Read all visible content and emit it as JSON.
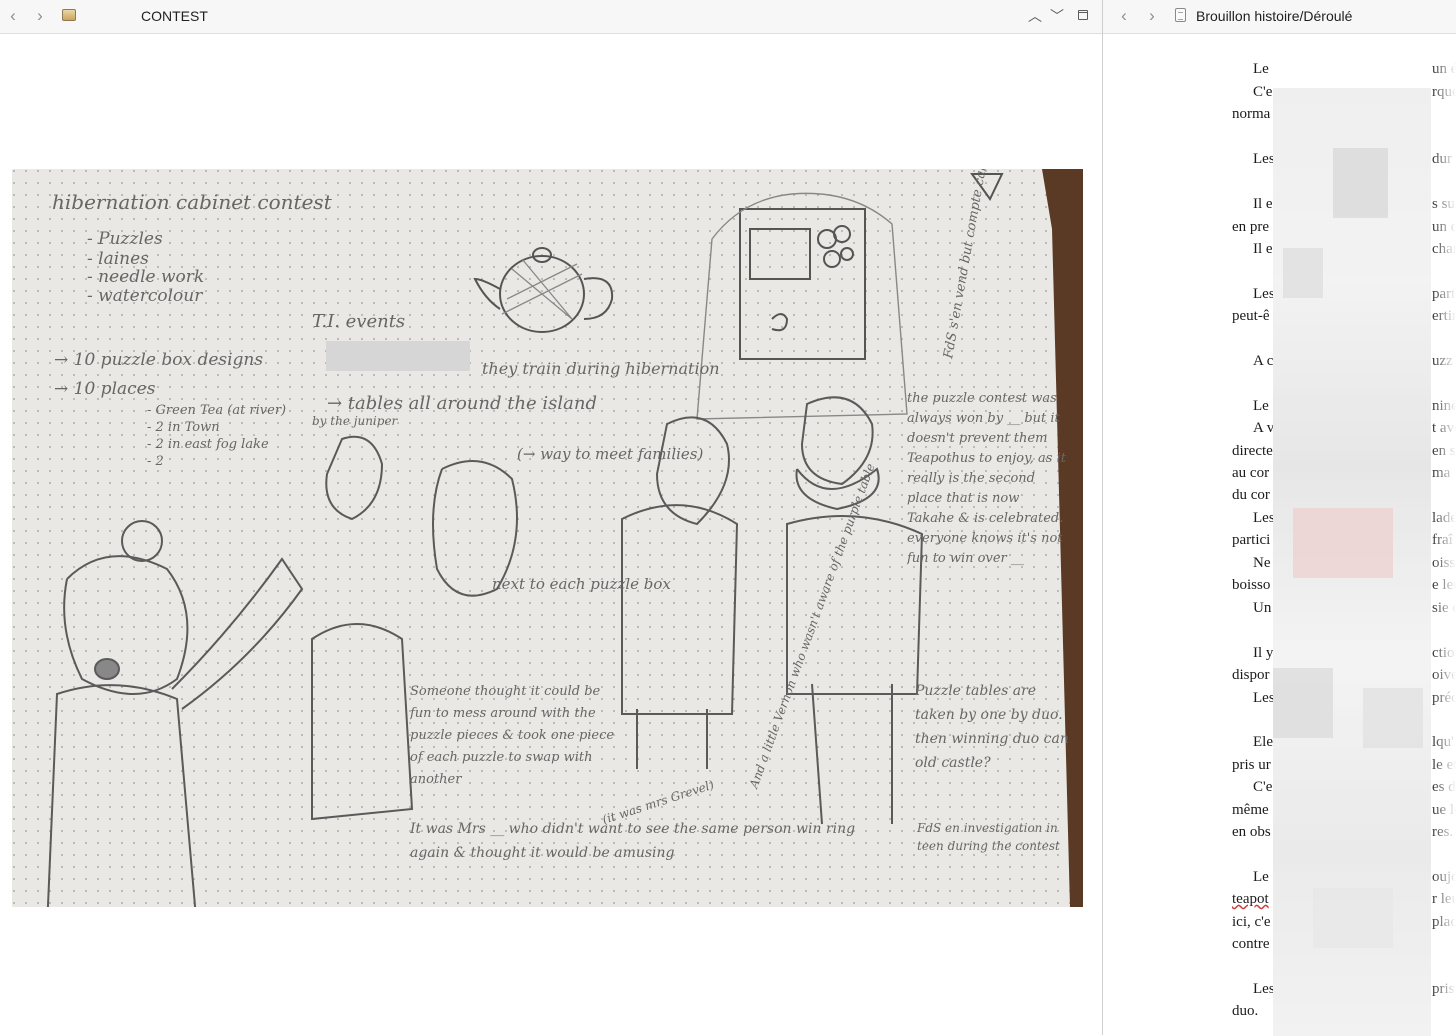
{
  "left_window": {
    "title": "CONTEST",
    "nav_back_icon": "chevron-left-icon",
    "nav_forward_icon": "chevron-right-icon",
    "file_icon": "image-file-icon",
    "controls": [
      "chevron-up-icon",
      "chevron-down-icon",
      "window-icon"
    ]
  },
  "right_window": {
    "title": "Brouillon histoire/Déroulé",
    "nav_back_icon": "chevron-left-icon",
    "nav_forward_icon": "chevron-right-icon",
    "file_icon": "document-icon"
  },
  "notebook": {
    "heading": "hibernation cabinet contest",
    "list_items": [
      "- Puzzles",
      "- laines",
      "- needle work",
      "- watercolour"
    ],
    "ti_label": "T.I. events",
    "puzzle_box": "→ 10 puzzle box designs",
    "places": "→ 10 places",
    "places_list": [
      "- Green Tea (at river)",
      "- 2 in Town",
      "- 2 in east fog lake",
      "- 2"
    ],
    "tables": "→ tables all around the island",
    "juniper": "by the juniper",
    "train": "they train during hibernation",
    "way_to": "(→ way to meet families)",
    "next_to": "next to each puzzle box",
    "side_note": "FdS s'en vend but compte cal but puzzle",
    "puzzle_contest": "the puzzle contest was always won by __ but it doesn't prevent them Teapothus to enjoy, as it really is the second place that is now Takahe & is celebrated. everyone knows it's not fun to win over __",
    "someone": "Someone thought it could be fun to mess around with the puzzle pieces & took one piece of each puzzle to swap with another",
    "it_was": "It was Mrs __ who didn't want to see the same person win ring again & thought it would be amusing",
    "puzzle_tables": "Puzzle tables are taken by one by duo. then winning duo can old castle?",
    "fds_invest": "FdS en investigation in teen during the contest",
    "diagonal_note": "And a little Vernon who wasn't aware of the purple table",
    "mrs_note": "(it was mrs Grevel)"
  },
  "document": {
    "lines": [
      {
        "left": "Le",
        "right": "un é"
      },
      {
        "left": "C'e",
        "right": "rque"
      },
      {
        "left": "norma",
        "right": ""
      },
      {
        "left": "Les",
        "right": "dur"
      },
      {
        "left": "Il e",
        "right": "s su"
      },
      {
        "left": "en pre",
        "right": "un c"
      },
      {
        "left": "Il e",
        "right": "char"
      },
      {
        "left": "Les",
        "right": "part"
      },
      {
        "left": "peut-ê",
        "right": "ertir"
      },
      {
        "left": "A c",
        "right": "uzz"
      },
      {
        "left": "Le",
        "right": "niné"
      },
      {
        "left": "A v",
        "right": "t ave"
      },
      {
        "left": "directe",
        "right": "en s"
      },
      {
        "left": "au cor",
        "right": "ma"
      },
      {
        "left": "du cor",
        "right": ""
      },
      {
        "left": "Les",
        "right": "lade"
      },
      {
        "left": "partici",
        "right": "fraî"
      },
      {
        "left": "Ne",
        "right": "oisso"
      },
      {
        "left": "boisso",
        "right": "e leu"
      },
      {
        "left": "Un",
        "right": "sie d"
      },
      {
        "left": "Il y",
        "right": "ction"
      },
      {
        "left": "dispor",
        "right": "oive"
      },
      {
        "left": "Les",
        "right": "préc"
      },
      {
        "left": "Ele",
        "right": "lqu'"
      },
      {
        "left": "pris ur",
        "right": "le et"
      },
      {
        "left": "C'e",
        "right": "es do"
      },
      {
        "left": "même",
        "right": "ue le"
      },
      {
        "left": "en obs",
        "right": "res."
      },
      {
        "left": "Le",
        "right": "oujo"
      },
      {
        "left": "teapot",
        "right": "r leu"
      },
      {
        "left": "ici, c'e",
        "right": "plac"
      },
      {
        "left": "contre",
        "right": ""
      },
      {
        "left": "Les",
        "right": "pris"
      },
      {
        "left": "duo.",
        "right": ""
      }
    ]
  },
  "colors": {
    "titlebar_bg": "#f7f7f7",
    "paper": "#e7e6e3",
    "pencil": "#666666"
  }
}
